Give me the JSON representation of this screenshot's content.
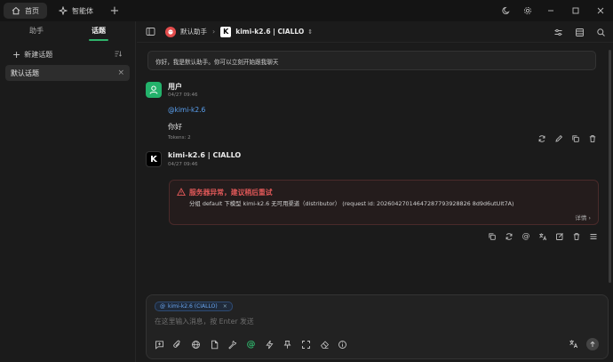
{
  "titlebar": {
    "tabs": [
      {
        "label": "首页",
        "icon": "home-icon",
        "active": true
      },
      {
        "label": "智能体",
        "icon": "agent-icon",
        "active": false
      }
    ],
    "new_tab_icon": "plus-icon",
    "controls": [
      "moon-icon",
      "gear-icon",
      "minimize-icon",
      "maximize-icon",
      "close-icon"
    ]
  },
  "sidebar": {
    "tabs": [
      "助手",
      "话题"
    ],
    "active_tab": "话题",
    "new_topic_label": "新建话题",
    "topics": [
      {
        "label": "默认话题"
      }
    ]
  },
  "header": {
    "assistant_name": "默认助手",
    "model_name": "kimi-k2.6 | CIALLO",
    "model_logo_letter": "K"
  },
  "chat": {
    "greeting": "你好，我是默认助手。你可以立刻开始跟我聊天",
    "user_message": {
      "name": "用户",
      "time": "04/27 09:46",
      "mention": "@kimi-k2.6",
      "text": "你好",
      "tokens": "Tokens: 2"
    },
    "assistant_message": {
      "name": "kimi-k2.6 | CIALLO",
      "time": "04/27 09:46",
      "error_title": "服务器异常，建议稍后重试",
      "error_detail": "分组 default 下模型 kimi-k2.6 无可用渠道（distributor） (request id: 20260427014647287793928826 8d9d6utUlt7A)",
      "error_more": "详情"
    }
  },
  "input": {
    "chip_label": "kimi-k2.6 (CIALLO)",
    "placeholder": "在这里输入消息，按 Enter 发送"
  },
  "colors": {
    "accent_green": "#2fb46b",
    "error_red": "#e05858",
    "mention_blue": "#5aa0f0"
  }
}
